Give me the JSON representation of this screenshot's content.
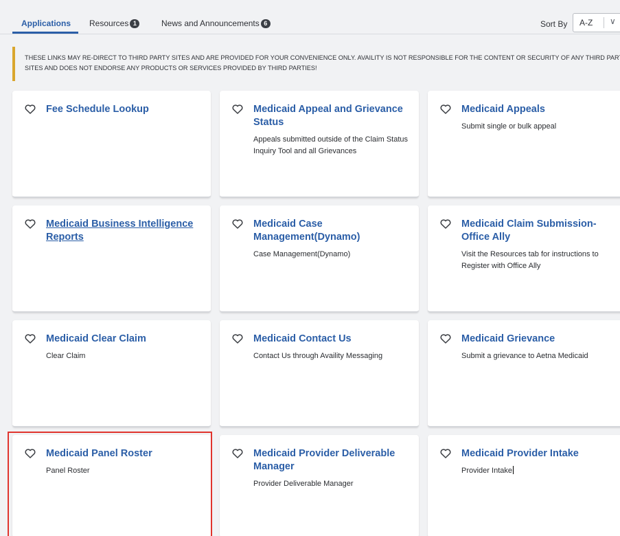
{
  "tabs": [
    {
      "label": "Applications",
      "active": true
    },
    {
      "label": "Resources",
      "badge": "1"
    },
    {
      "label": "News and Announcements",
      "badge": "6"
    }
  ],
  "sort": {
    "label": "Sort By",
    "value": "A-Z"
  },
  "notice": {
    "text": "THESE LINKS MAY RE-DIRECT TO THIRD PARTY SITES AND ARE PROVIDED FOR YOUR CONVENIENCE ONLY. AVAILITY IS NOT RESPONSIBLE FOR THE CONTENT OR SECURITY OF ANY THIRD PARTY SITES AND DOES NOT ENDORSE ANY PRODUCTS OR SERVICES PROVIDED BY THIRD PARTIES!",
    "accent_color": "#d9a62e"
  },
  "colors": {
    "link": "#2b5ea7",
    "highlight": "#e0342d"
  },
  "cards": [
    {
      "title": "Fee Schedule Lookup",
      "description": ""
    },
    {
      "title": "Medicaid Appeal and Grievance Status",
      "description": "Appeals submitted outside of the Claim Status Inquiry Tool and all Grievances"
    },
    {
      "title": "Medicaid Appeals",
      "description": "Submit single or bulk appeal"
    },
    {
      "title": "Medicaid Business Intelligence Reports",
      "description": ""
    },
    {
      "title": "Medicaid Case Management(Dynamo)",
      "description": "Case Management(Dynamo)"
    },
    {
      "title": "Medicaid Claim Submission-Office Ally",
      "description": "Visit the Resources tab for instructions to Register with Office Ally"
    },
    {
      "title": "Medicaid Clear Claim",
      "description": "Clear Claim"
    },
    {
      "title": "Medicaid Contact Us",
      "description": "Contact Us through Availity Messaging"
    },
    {
      "title": "Medicaid Grievance",
      "description": "Submit a grievance to Aetna Medicaid"
    },
    {
      "title": "Medicaid Panel Roster",
      "description": "Panel Roster"
    },
    {
      "title": "Medicaid Provider Deliverable Manager",
      "description": "Provider Deliverable Manager"
    },
    {
      "title": "Medicaid Provider Intake",
      "description": "Provider Intake"
    }
  ]
}
